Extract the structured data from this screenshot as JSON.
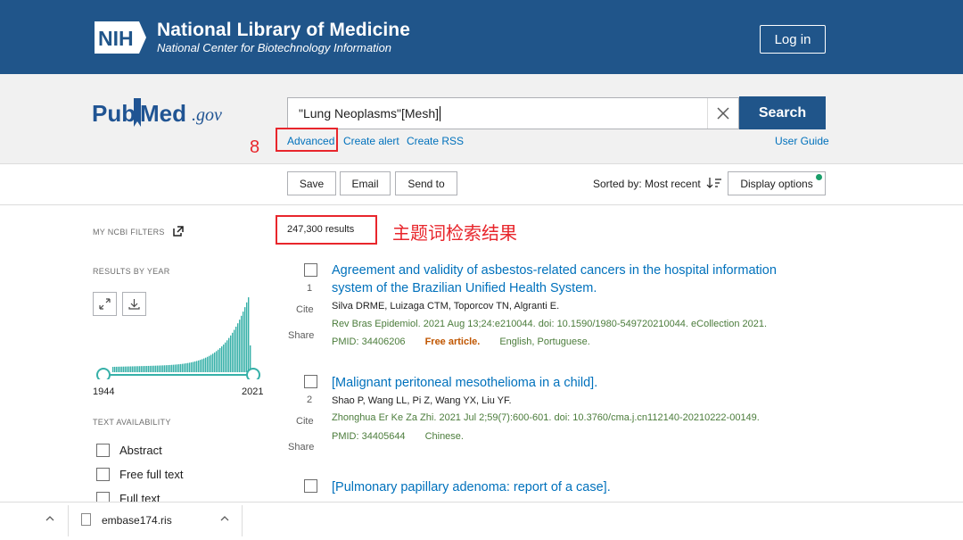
{
  "header": {
    "logo_text": "NIH",
    "title": "National Library of Medicine",
    "subtitle": "National Center for Biotechnology Information",
    "login_label": "Log in"
  },
  "search": {
    "logo_pub": "Pub",
    "logo_med": "Med",
    "logo_gov": ".gov",
    "query": "\"Lung Neoplasms\"[Mesh]",
    "button_label": "Search",
    "advanced_label": "Advanced",
    "create_alert_label": "Create alert",
    "create_rss_label": "Create RSS",
    "user_guide_label": "User Guide",
    "annotation_number": "8"
  },
  "actions": {
    "save_label": "Save",
    "email_label": "Email",
    "send_to_label": "Send to",
    "sorted_label": "Sorted by: Most recent",
    "display_options_label": "Display options"
  },
  "sidebar": {
    "my_ncbi_filters": "MY NCBI FILTERS",
    "results_by_year": "RESULTS BY YEAR",
    "year_start": "1944",
    "year_end": "2021",
    "text_availability": "TEXT AVAILABILITY",
    "filters": [
      "Abstract",
      "Free full text",
      "Full text"
    ]
  },
  "results": {
    "count_label": "247,300 results",
    "annotation": "主题词检索结果",
    "cite_label": "Cite",
    "share_label": "Share",
    "items": [
      {
        "number": "1",
        "title_line1": "Agreement and validity of asbestos-related cancers in the hospital information",
        "title_line2": "system of the Brazilian Unified Health System.",
        "authors": "Silva DRME, Luizaga CTM, Toporcov TN, Algranti E.",
        "journal": "Rev Bras Epidemiol. 2021 Aug 13;24:e210044. doi: 10.1590/1980-549720210044. eCollection 2021.",
        "pmid": "PMID: 34406206",
        "free": "Free article.",
        "language": "English, Portuguese."
      },
      {
        "number": "2",
        "title_line1": "[Malignant peritoneal mesothelioma in a child].",
        "authors": "Shao P, Wang LL, Pi Z, Wang YX, Liu YF.",
        "journal": "Zhonghua Er Ke Za Zhi. 2021 Jul 2;59(7):600-601. doi: 10.3760/cma.j.cn112140-20210222-00149.",
        "pmid": "PMID: 34405644",
        "language": "Chinese."
      },
      {
        "title_line1": "[Pulmonary papillary adenoma: report of a case]."
      }
    ]
  },
  "download": {
    "filename": "embase174.ris"
  },
  "colors": {
    "header_bg": "#20558a",
    "link": "#0071bc",
    "annotation_red": "#e8262c",
    "histogram": "#36b0a8"
  }
}
